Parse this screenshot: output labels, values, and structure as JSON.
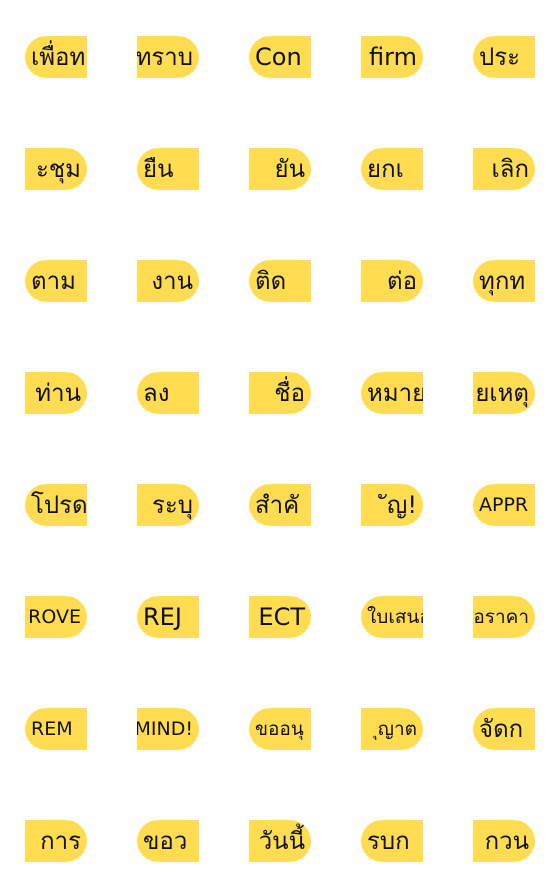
{
  "pill_color": "#FFDC50",
  "stickers": [
    {
      "text": "เพื่อท",
      "side": "left"
    },
    {
      "text": "ทราบ",
      "side": "right"
    },
    {
      "text": "Con",
      "side": "left"
    },
    {
      "text": "firm",
      "side": "right"
    },
    {
      "text": "ประ",
      "side": "left"
    },
    {
      "text": "ะชุม",
      "side": "right"
    },
    {
      "text": "ยืน",
      "side": "left"
    },
    {
      "text": "ยัน",
      "side": "right"
    },
    {
      "text": "ยกเ",
      "side": "left"
    },
    {
      "text": "เลิก",
      "side": "right"
    },
    {
      "text": "ตาม",
      "side": "left"
    },
    {
      "text": "งาน",
      "side": "right"
    },
    {
      "text": "ติด",
      "side": "left"
    },
    {
      "text": "ต่อ",
      "side": "right"
    },
    {
      "text": "ทุกท",
      "side": "left"
    },
    {
      "text": "ท่าน",
      "side": "right"
    },
    {
      "text": "ลง",
      "side": "left"
    },
    {
      "text": "ชื่อ",
      "side": "right"
    },
    {
      "text": "หมาย",
      "side": "left"
    },
    {
      "text": "ยเหตุ",
      "side": "right"
    },
    {
      "text": "โปรด",
      "side": "left"
    },
    {
      "text": "ระบุ",
      "side": "right"
    },
    {
      "text": "สำคั",
      "side": "left"
    },
    {
      "text": "ัญ!",
      "side": "right"
    },
    {
      "text": "APPR",
      "side": "left",
      "small": true
    },
    {
      "text": "ROVE",
      "side": "right",
      "small": true
    },
    {
      "text": "REJ",
      "side": "left"
    },
    {
      "text": "ECT",
      "side": "right"
    },
    {
      "text": "ใบเสนอ",
      "side": "left",
      "small": true
    },
    {
      "text": "อราคา",
      "side": "right",
      "small": true
    },
    {
      "text": "REM",
      "side": "left",
      "small": true
    },
    {
      "text": "MIND!",
      "side": "right",
      "small": true
    },
    {
      "text": "ขออนุ",
      "side": "left",
      "small": true
    },
    {
      "text": "ุญาต",
      "side": "right",
      "small": true
    },
    {
      "text": "จัดก",
      "side": "left"
    },
    {
      "text": "การ",
      "side": "right"
    },
    {
      "text": "ขอว",
      "side": "left"
    },
    {
      "text": "วันนี้",
      "side": "right"
    },
    {
      "text": "รบก",
      "side": "left"
    },
    {
      "text": "กวน",
      "side": "right"
    }
  ]
}
